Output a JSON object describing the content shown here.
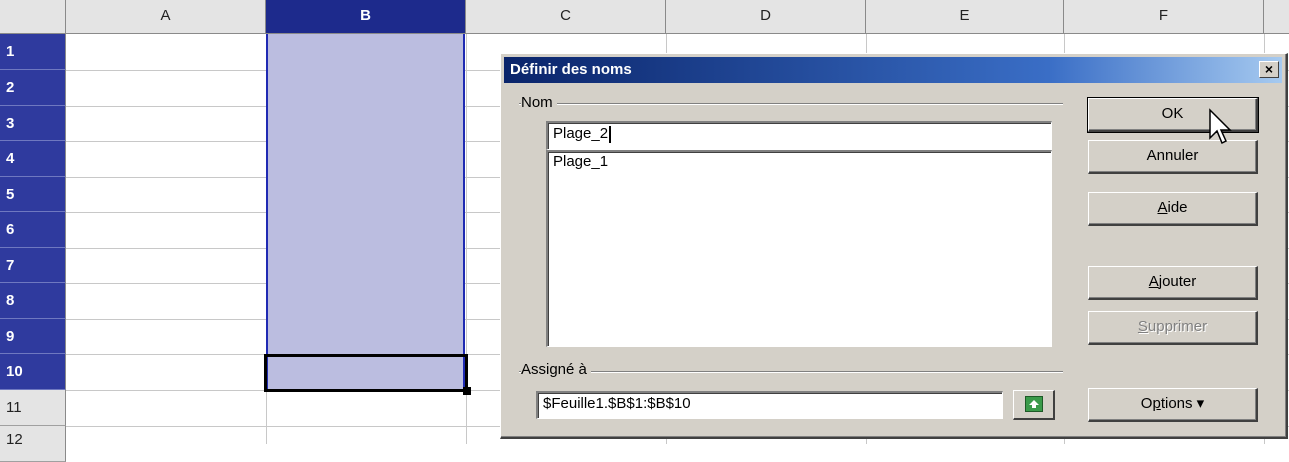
{
  "columns": [
    "A",
    "B",
    "C",
    "D",
    "E",
    "F"
  ],
  "selected_column": "B",
  "rows": [
    "1",
    "2",
    "3",
    "4",
    "5",
    "6",
    "7",
    "8",
    "9",
    "10",
    "11",
    "12"
  ],
  "dialog": {
    "title": "Définir des noms",
    "close_label": "×",
    "name_group_label": "Nom",
    "name_input_value": "Plage_2",
    "names_list": [
      "Plage_1"
    ],
    "assigned_group_label": "Assigné à",
    "assigned_value": "$Feuille1.$B$1:$B$10",
    "buttons": {
      "ok": "OK",
      "cancel": "Annuler",
      "help_pre": "",
      "help_u": "A",
      "help_post": "ide",
      "add_pre": "",
      "add_u": "A",
      "add_post": "jouter",
      "delete_pre": "",
      "delete_u": "S",
      "delete_post": "upprimer",
      "options_pre": "O",
      "options_u": "p",
      "options_post": "tions ▾"
    }
  },
  "colors": {
    "selection_fill": "#bbbde0",
    "selection_header": "#1d2a8c",
    "title_gradient_start": "#0a246a"
  }
}
